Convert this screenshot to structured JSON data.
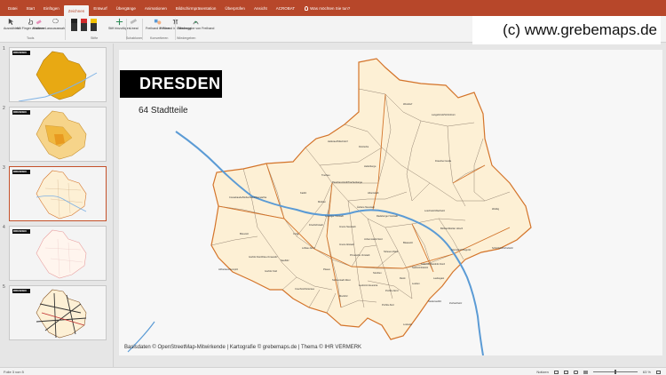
{
  "app": {
    "tabs": [
      "Datei",
      "Start",
      "Einfügen",
      "Zeichnen",
      "Entwurf",
      "Übergänge",
      "Animationen",
      "Bildschirmpräsentation",
      "Überprüfen",
      "Ansicht",
      "ACROBAT"
    ],
    "active_tab": "Zeichnen",
    "tell_me": "Was möchten Sie tun?",
    "accent": "#b7472a"
  },
  "watermark": "(c) www.grebemaps.de",
  "ribbon": {
    "tools": [
      "Auswählen",
      "Mit Finger zeichnen",
      "Radierer",
      "Lassoauswahl"
    ],
    "tools_group": "Tools",
    "pens_group": "Stifte",
    "pen_add": "Stift hinzufügen",
    "ruler": "Lineal",
    "ruler_group": "Schablonen",
    "convert_shape": "Freihand in Form",
    "convert_math": "Freihand in Gleichung",
    "convert_group": "Konvertieren",
    "replay": "Wiedergabe von Freihand",
    "replay_group": "Wiedergeben"
  },
  "thumbnails": {
    "numbers": [
      "1",
      "2",
      "3",
      "4",
      "5"
    ],
    "title": "DRESDEN",
    "selected": 3
  },
  "slide": {
    "title": "DRESDEN",
    "subtitle": "64 Stadtteile",
    "footer": "Basisdaten © OpenStreetMap-Mitwirkende | Kartografie © grebemaps.de | Thema © IHR VERMERK",
    "map_fill": "#fdf0d5",
    "map_border": "#d4742a",
    "river_color": "#5b9bd5"
  },
  "districts": [
    "Langebrück/Schönborn",
    "Hellerau/Wilschdorf",
    "Klotzsche",
    "Weixdorf",
    "Dresdner Heide",
    "Hellerberge",
    "Albertstadt",
    "Cossebaude/Mobschatz/Oberwartha",
    "Kaditz",
    "Mickten",
    "Trachau",
    "Pieschen-Nord/Trachenberge",
    "Leipziger Vorstadt",
    "Äußere Neustadt",
    "Innere Neustadt",
    "Radeberger Vorstadt",
    "Loschwitz/Wachwitz",
    "Bühlau/Weißer Hirsch",
    "Weißig",
    "Schönfeld/Schullwitz",
    "Gönnsdorf/Pappritz",
    "Briesnitz",
    "Cotta",
    "Löbtau-Nord",
    "Friedrichstadt",
    "Innere Altstadt",
    "Pirnaische Vorstadt",
    "Johannstadt-Nord",
    "Striesen-West",
    "Blasewitz",
    "Tolkewitz/Seidnitz-Nord",
    "Gorbitz-Nord/Neu-Omsewitz",
    "Gorbitz-Süd",
    "Naußlitz",
    "Plauen",
    "Südvorstadt-West",
    "Strehlen",
    "Leuben",
    "Laubegast",
    "Zschachwitz",
    "Niedersedlitz",
    "Lockwitz",
    "Prohlis-Nord",
    "Prohlis-Süd",
    "Coschütz/Gittersee",
    "Mockritz",
    "Leubnitz-Neuostra",
    "Altfranken/Gompitz",
    "Reick",
    "Seidnitz/Dobritz"
  ],
  "status": {
    "slide_info": "Folie 3 von 5",
    "notes": "Notizen",
    "zoom": "63 %"
  }
}
